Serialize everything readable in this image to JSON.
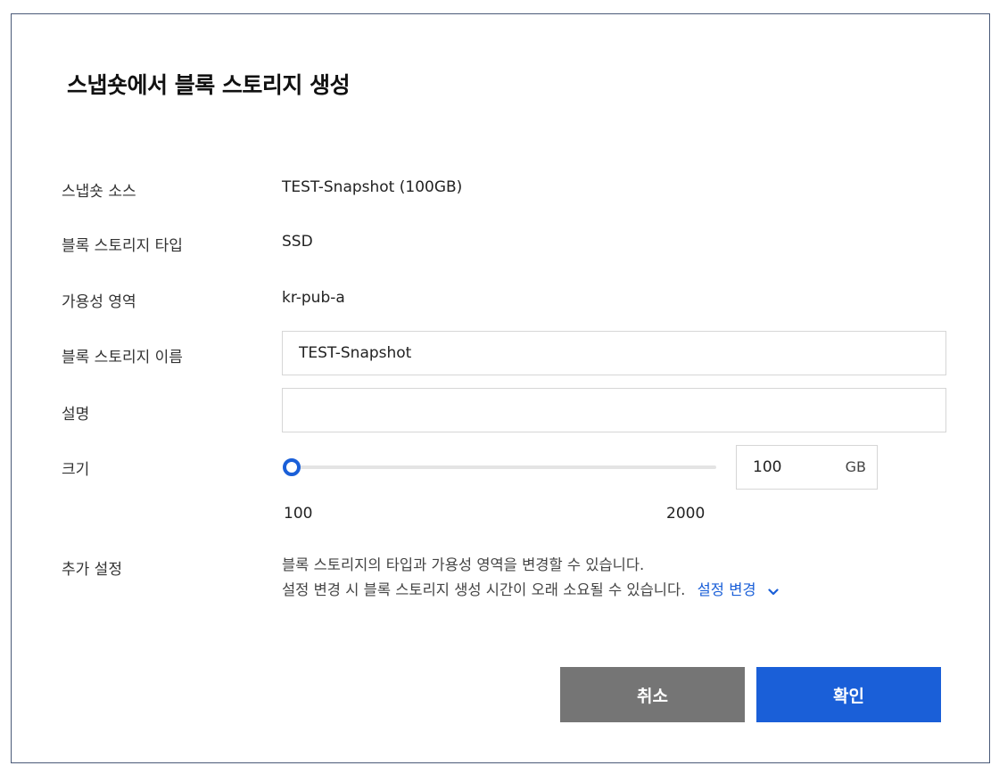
{
  "dialog": {
    "title": "스냅숏에서 블록 스토리지 생성"
  },
  "form": {
    "snapshot_source": {
      "label": "스냅숏 소스",
      "value": "TEST-Snapshot (100GB)"
    },
    "storage_type": {
      "label": "블록 스토리지 타입",
      "value": "SSD"
    },
    "availability_zone": {
      "label": "가용성 영역",
      "value": "kr-pub-a"
    },
    "storage_name": {
      "label": "블록 스토리지 이름",
      "value": "TEST-Snapshot",
      "placeholder": ""
    },
    "description": {
      "label": "설명",
      "value": "",
      "placeholder": ""
    },
    "size": {
      "label": "크기",
      "value": "100",
      "unit": "GB",
      "min_label": "100",
      "max_label": "2000",
      "min": 100,
      "max": 2000,
      "current": 100
    },
    "extra_settings": {
      "label": "추가 설정",
      "line1": "블록 스토리지의 타입과 가용성 영역을 변경할 수 있습니다.",
      "line2": "설정 변경 시 블록 스토리지 생성 시간이 오래 소요될 수 있습니다.",
      "link": "설정 변경",
      "link_icon": "chevron-down-icon"
    }
  },
  "buttons": {
    "cancel": "취소",
    "confirm": "확인"
  },
  "colors": {
    "primary": "#1a5fd8",
    "cancel": "#757575",
    "border": "#4a5a78"
  }
}
